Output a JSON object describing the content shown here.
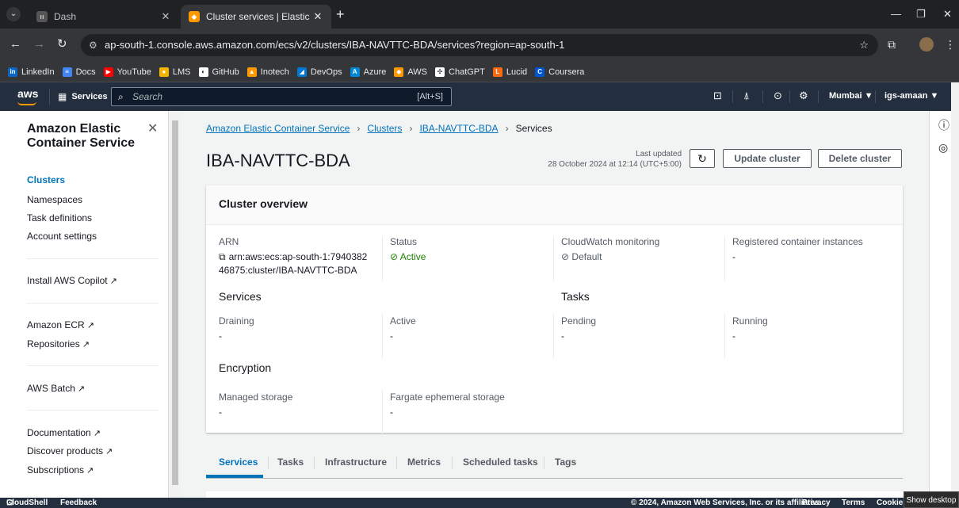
{
  "browser": {
    "tabs": [
      {
        "title": "Dash",
        "favicon": "dash-favicon"
      },
      {
        "title": "Cluster services | Elastic Contain",
        "favicon": "aws-favicon"
      }
    ],
    "url": "ap-south-1.console.aws.amazon.com/ecs/v2/clusters/IBA-NAVTTC-BDA/services?region=ap-south-1",
    "bookmarks": [
      {
        "label": "LinkedIn",
        "color": "#0a66c2",
        "glyph": "in"
      },
      {
        "label": "Docs",
        "color": "#4285f4",
        "glyph": "≡"
      },
      {
        "label": "YouTube",
        "color": "#ff0000",
        "glyph": "▶"
      },
      {
        "label": "LMS",
        "color": "#f4b400",
        "glyph": "●"
      },
      {
        "label": "GitHub",
        "color": "#ffffff",
        "glyph": "◐"
      },
      {
        "label": "Inotech",
        "color": "#ff9900",
        "glyph": "▲"
      },
      {
        "label": "DevOps",
        "color": "#0078d4",
        "glyph": "◢"
      },
      {
        "label": "Azure",
        "color": "#0089d6",
        "glyph": "A"
      },
      {
        "label": "AWS",
        "color": "#ff9900",
        "glyph": "◆"
      },
      {
        "label": "ChatGPT",
        "color": "#ffffff",
        "glyph": "✣"
      },
      {
        "label": "Lucid",
        "color": "#f96b13",
        "glyph": "L"
      },
      {
        "label": "Coursera",
        "color": "#0056d2",
        "glyph": "C"
      }
    ]
  },
  "awsnav": {
    "logo": "aws",
    "services": "Services",
    "search_placeholder": "Search",
    "search_shortcut": "[Alt+S]",
    "region": "Mumbai ▼",
    "account": "igs-amaan ▼"
  },
  "sidebar": {
    "title": "Amazon Elastic Container Service",
    "items": [
      {
        "label": "Clusters",
        "active": true
      },
      {
        "label": "Namespaces"
      },
      {
        "label": "Task definitions"
      },
      {
        "label": "Account settings"
      }
    ],
    "copilot": "Install AWS Copilot",
    "ecr": "Amazon ECR",
    "repositories": "Repositories",
    "batch": "AWS Batch",
    "documentation": "Documentation",
    "discover": "Discover products",
    "subscriptions": "Subscriptions"
  },
  "breadcrumb": {
    "root": "Amazon Elastic Container Service",
    "clusters": "Clusters",
    "cluster": "IBA-NAVTTC-BDA",
    "current": "Services"
  },
  "page": {
    "title": "IBA-NAVTTC-BDA",
    "last_updated_label": "Last updated",
    "last_updated_value": "28 October 2024 at 12:14 (UTC+5:00)",
    "update_button": "Update cluster",
    "delete_button": "Delete cluster"
  },
  "overview": {
    "title": "Cluster overview",
    "arn_label": "ARN",
    "arn_value": "arn:aws:ecs:ap-south-1:794038246875:cluster/IBA-NAVTTC-BDA",
    "status_label": "Status",
    "status_value": "Active",
    "cloudwatch_label": "CloudWatch monitoring",
    "cloudwatch_value": "Default",
    "registered_label": "Registered container instances",
    "registered_value": "-",
    "services_title": "Services",
    "tasks_title": "Tasks",
    "draining_label": "Draining",
    "draining_value": "-",
    "active_label": "Active",
    "active_value": "-",
    "pending_label": "Pending",
    "pending_value": "-",
    "running_label": "Running",
    "running_value": "-",
    "encryption_title": "Encryption",
    "managed_label": "Managed storage",
    "managed_value": "-",
    "fargate_label": "Fargate ephemeral storage",
    "fargate_value": "-"
  },
  "content_tabs": [
    {
      "label": "Services",
      "active": true
    },
    {
      "label": "Tasks"
    },
    {
      "label": "Infrastructure"
    },
    {
      "label": "Metrics"
    },
    {
      "label": "Scheduled tasks"
    },
    {
      "label": "Tags"
    }
  ],
  "footer": {
    "cloudshell": "CloudShell",
    "feedback": "Feedback",
    "copyright": "© 2024, Amazon Web Services, Inc. or its affiliates.",
    "privacy": "Privacy",
    "terms": "Terms",
    "cookie": "Cookie"
  },
  "taskbar": {
    "show_desktop": "Show desktop"
  }
}
